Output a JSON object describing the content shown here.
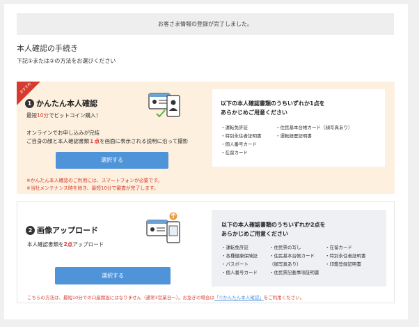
{
  "notice": "お客さま情報の登録が完了しました。",
  "section": {
    "title": "本人確認の手続き",
    "subtitle": "下記①または②の方法をお選びください"
  },
  "method1": {
    "ribbon": "おすすめ",
    "number": "1",
    "title": "かんたん本人確認",
    "tagline_prefix": "最短",
    "tagline_highlight": "10分",
    "tagline_suffix": "でビットコイン購入！",
    "desc_line1": "オンラインでお申し込みが完結",
    "desc_line2_prefix": "ご自身の顔と本人確認書類",
    "desc_line2_highlight": "１点",
    "desc_line2_suffix": "を画面に表示される説明に沿って撮影",
    "button": "選択する",
    "note1": "※かんたん本人確認のご利用には、スマートフォンが必要です。",
    "note2": "※当社メンテナンス時を除き、最短10分で審査が完了します。",
    "docs_heading1": "以下の本人確認書類のうちいずれか1点を",
    "docs_heading2": "あらかじめご用意ください",
    "docs_col1": [
      "・運転免許証",
      "・特別永住者証明書",
      "・個人番号カード",
      "・在留カード"
    ],
    "docs_col2": [
      "・住民基本台帳カード（顔写真あり）",
      "・運転経歴証明書"
    ]
  },
  "method2": {
    "number": "2",
    "title": "画像アップロード",
    "desc_prefix": "本人確認書類を",
    "desc_highlight": "2点",
    "desc_suffix": "アップロード",
    "button": "選択する",
    "note_prefix": "こちらの方法は、最短10分での口座開設にはなりません（通常3営業日〜）。お急ぎの場合は",
    "note_link": "「①かんたん本人確認」",
    "note_suffix": "をご利用ください。",
    "docs_heading1": "以下の本人確認書類のうちいずれか2点を",
    "docs_heading2": "あらかじめご用意ください",
    "docs_col1": [
      "・運転免許証",
      "・各種健康保険証",
      "・パスポート",
      "・個人番号カード"
    ],
    "docs_col2": [
      "・住民票の写し",
      "・住民基本台帳カード",
      "（顔写真あり）",
      "・住民票記載事項証明書"
    ],
    "docs_col3": [
      "・在留カード",
      "・特別永住者証明書",
      "・印鑑登録証明書"
    ]
  },
  "colors": {
    "accent": "#4f93d9",
    "warn": "#d73b2f",
    "card1_bg": "#fdf0de"
  }
}
